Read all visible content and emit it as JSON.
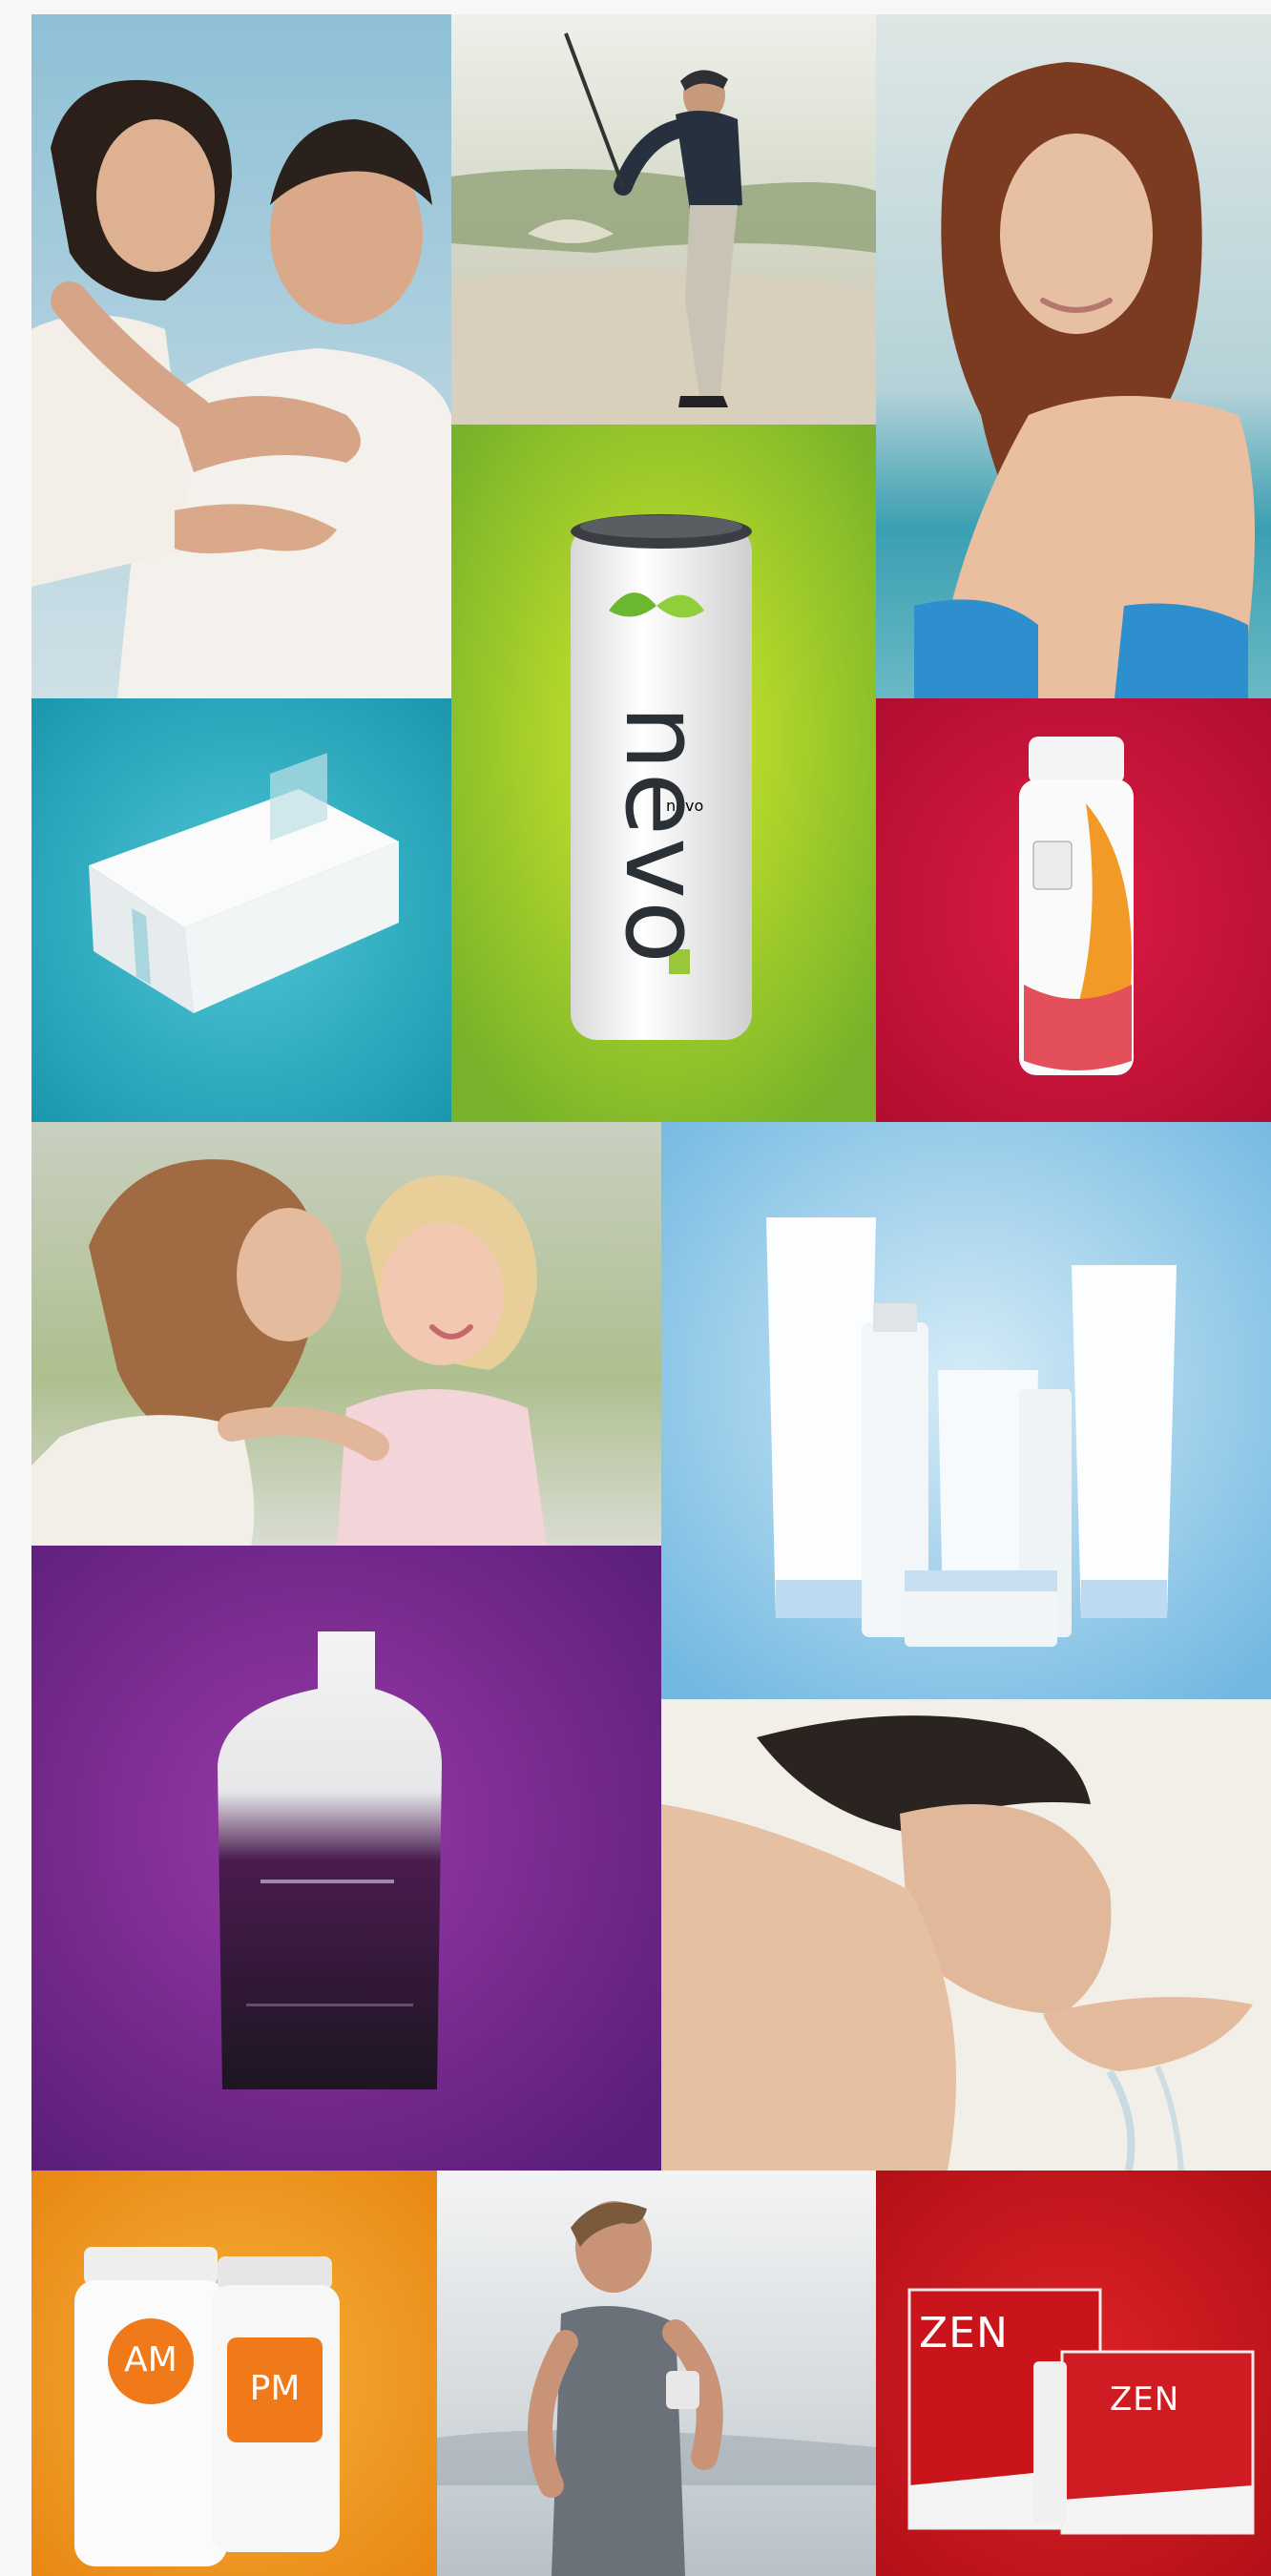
{
  "collage": {
    "tiles": [
      {
        "subject": "couple-embracing",
        "bg": "#9fc3d6"
      },
      {
        "subject": "golfer-swinging",
        "bg": "#c9cdb8"
      },
      {
        "subject": "woman-smiling-beach",
        "bg": "#b8d2dc"
      },
      {
        "subject": "white-product-box",
        "bg": "#25a9bd"
      },
      {
        "subject": "nevo-can",
        "bg": "#8ec22a"
      },
      {
        "subject": "supplement-bottle",
        "bg": "#c8133a"
      },
      {
        "subject": "mother-and-child",
        "bg": "#d8dcc8"
      },
      {
        "subject": "skincare-products",
        "bg": "#8cc6e8"
      },
      {
        "subject": "drink-pouch",
        "bg": "#6e2389"
      },
      {
        "subject": "woman-washing-face",
        "bg": "#efeee6"
      },
      {
        "subject": "am-pm-bottles",
        "bg": "#f3a21a"
      },
      {
        "subject": "man-running",
        "bg": "#e4e7ea"
      },
      {
        "subject": "zen-product-pack",
        "bg": "#c7161f"
      }
    ]
  },
  "products": {
    "can_label": "nevo",
    "am_label": "AM",
    "pm_label": "PM",
    "zen_label_1": "ZEN",
    "zen_label_2": "ZEN"
  }
}
